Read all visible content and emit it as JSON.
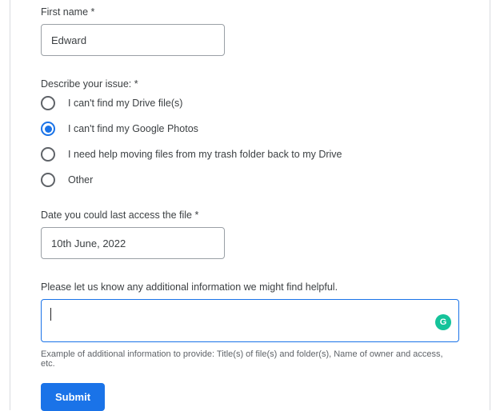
{
  "firstName": {
    "label": "First name *",
    "value": "Edward"
  },
  "issue": {
    "label": "Describe your issue: *",
    "options": [
      {
        "label": "I can't find my Drive file(s)",
        "selected": false
      },
      {
        "label": "I can't find my Google Photos",
        "selected": true
      },
      {
        "label": "I need help moving files from my trash folder back to my Drive",
        "selected": false
      },
      {
        "label": "Other",
        "selected": false
      }
    ]
  },
  "lastAccess": {
    "label": "Date you could last access the file *",
    "value": "10th June, 2022"
  },
  "additional": {
    "label": "Please let us know any additional information we might find helpful.",
    "value": "",
    "helper": "Example of additional information to provide: Title(s) of file(s) and folder(s), Name of owner and access, etc."
  },
  "submit": {
    "label": "Submit"
  },
  "grammarly": {
    "letter": "G"
  }
}
